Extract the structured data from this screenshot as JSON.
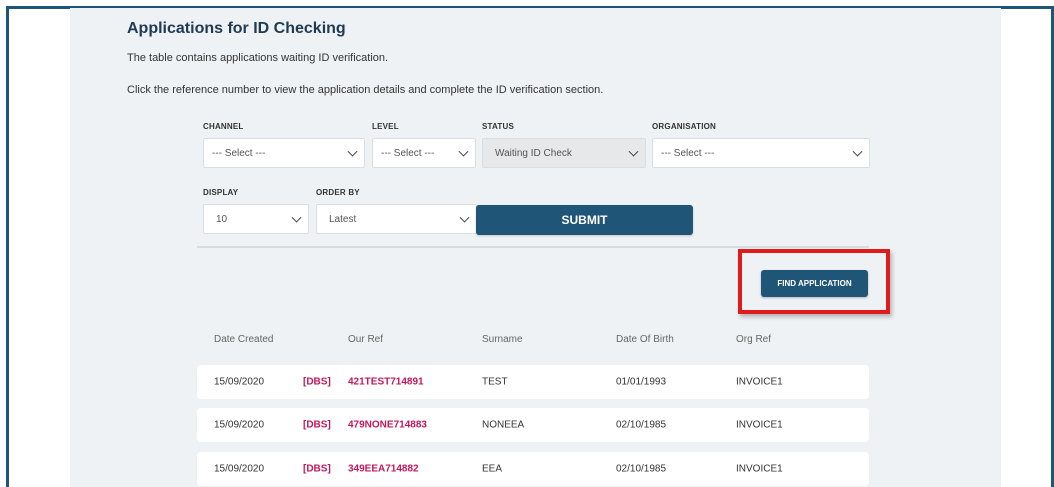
{
  "page": {
    "title": "Applications for ID Checking",
    "subtitle": "The table contains applications waiting ID verification.",
    "instructions": "Click the reference number to view the application details and complete the ID verification section."
  },
  "filters": {
    "channel": {
      "label": "CHANNEL",
      "value": "--- Select ---"
    },
    "level": {
      "label": "LEVEL",
      "value": "--- Select ---"
    },
    "status": {
      "label": "STATUS",
      "value": "Waiting ID Check"
    },
    "organisation": {
      "label": "ORGANISATION",
      "value": "--- Select ---"
    },
    "display": {
      "label": "DISPLAY",
      "value": "10"
    },
    "order_by": {
      "label": "ORDER BY",
      "value": "Latest"
    },
    "submit_label": "SUBMIT"
  },
  "find_application_label": "FIND APPLICATION",
  "table": {
    "headers": [
      "Date Created",
      "Our Ref",
      "Surname",
      "Date Of Birth",
      "Org Ref"
    ],
    "rows": [
      {
        "date_created": "15/09/2020",
        "tag": "[DBS]",
        "ref": "421TEST714891",
        "surname": "TEST",
        "dob": "01/01/1993",
        "org_ref": "INVOICE1"
      },
      {
        "date_created": "15/09/2020",
        "tag": "[DBS]",
        "ref": "479NONE714883",
        "surname": "NONEEA",
        "dob": "02/10/1985",
        "org_ref": "INVOICE1"
      },
      {
        "date_created": "15/09/2020",
        "tag": "[DBS]",
        "ref": "349EEA714882",
        "surname": "EEA",
        "dob": "02/10/1985",
        "org_ref": "INVOICE1"
      }
    ]
  },
  "colors": {
    "primary": "#1f5577",
    "highlight": "#e01b1b",
    "ref_link": "#c2185b",
    "panel_bg": "#eef2f5"
  },
  "icons": {
    "select_arrow": "chevron-down-icon"
  }
}
